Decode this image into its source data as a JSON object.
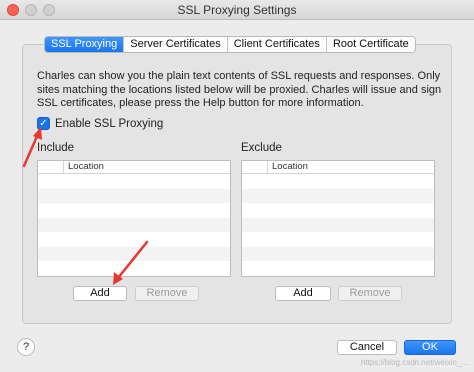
{
  "window": {
    "title": "SSL Proxying Settings"
  },
  "tabs": [
    {
      "label": "SSL Proxying",
      "active": true
    },
    {
      "label": "Server Certificates",
      "active": false
    },
    {
      "label": "Client Certificates",
      "active": false
    },
    {
      "label": "Root Certificate",
      "active": false
    }
  ],
  "description": "Charles can show you the plain text contents of SSL requests and responses. Only sites matching the locations listed below will be proxied. Charles will issue and sign SSL certificates, please press the Help button for more information.",
  "enable": {
    "label": "Enable SSL Proxying",
    "checked": true,
    "check_glyph": "✓"
  },
  "include": {
    "label": "Include",
    "column_header": "Location",
    "add_label": "Add",
    "remove_label": "Remove"
  },
  "exclude": {
    "label": "Exclude",
    "column_header": "Location",
    "add_label": "Add",
    "remove_label": "Remove"
  },
  "footer": {
    "help_label": "?",
    "cancel_label": "Cancel",
    "ok_label": "OK"
  },
  "watermark": "https://blog.csdn.net/weixin_...",
  "colors": {
    "accent": "#1a75ed",
    "annotation_arrow": "#e8382f"
  }
}
